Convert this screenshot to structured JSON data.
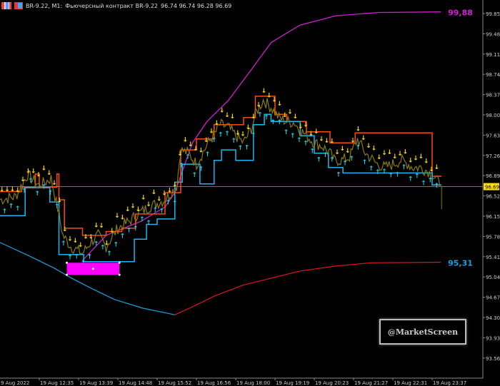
{
  "header": {
    "symbol": "BR-9.22, M1:",
    "description": "Фьючерсный контракт BR-9.22",
    "ohlc": "96.74 96.74 96.28 96.69"
  },
  "watermark": "@MarketScreen",
  "colors": {
    "price": "#8a7a10",
    "upper_step": "#ff4a10",
    "lower_step": "#18b8f0",
    "upper_envelope": "#d020d0",
    "lower_envelope_a": "#1aa0e0",
    "lower_envelope_b": "#dd1818",
    "arrow_down": "#ffe000",
    "arrow_up": "#20d0e0",
    "box": "#ff00ff",
    "axis": "#888888"
  },
  "chart_data": {
    "type": "line",
    "title": "BR-9.22, M1",
    "ylim": [
      93.4,
      100.0
    ],
    "yticks": [
      "99.85",
      "99.48",
      "99.11",
      "98.74",
      "98.37",
      "98.00",
      "97.63",
      "97.26",
      "96.89",
      "96.52",
      "96.15",
      "95.78",
      "95.41",
      "95.04",
      "94.67",
      "94.30",
      "93.93",
      "93.56"
    ],
    "xticks": [
      "9 Aug 2022",
      "19 Aug 12:35",
      "19 Aug 13:39",
      "19 Aug 14:48",
      "19 Aug 15:52",
      "19 Aug 16:56",
      "19 Aug 18:00",
      "19 Aug 19:19",
      "19 Aug 20:23",
      "19 Aug 21:27",
      "19 Aug 22:31",
      "19 Aug 23:37"
    ],
    "current_price": "96.69",
    "upper_label": "99,88",
    "lower_label": "95,31",
    "series": [
      {
        "name": "price",
        "points": [
          [
            0,
            96.45
          ],
          [
            4,
            96.51
          ],
          [
            7,
            96.91
          ],
          [
            10,
            96.71
          ],
          [
            13,
            96.84
          ],
          [
            15,
            96.19
          ],
          [
            16,
            95.8
          ],
          [
            18,
            95.6
          ],
          [
            21,
            95.47
          ],
          [
            23,
            95.67
          ],
          [
            25,
            95.8
          ],
          [
            27,
            95.6
          ],
          [
            30,
            95.93
          ],
          [
            33,
            96.06
          ],
          [
            35,
            96.19
          ],
          [
            38,
            96.32
          ],
          [
            42,
            96.45
          ],
          [
            45,
            96.71
          ],
          [
            46,
            97.36
          ],
          [
            48,
            97.3
          ],
          [
            50,
            97.1
          ],
          [
            53,
            97.49
          ],
          [
            55,
            97.69
          ],
          [
            56,
            97.82
          ],
          [
            58,
            97.78
          ],
          [
            60,
            97.62
          ],
          [
            62,
            97.49
          ],
          [
            64,
            97.75
          ],
          [
            65,
            98.01
          ],
          [
            67,
            98.27
          ],
          [
            69,
            98.14
          ],
          [
            71,
            97.95
          ],
          [
            73,
            97.88
          ],
          [
            75,
            97.86
          ],
          [
            76,
            97.75
          ],
          [
            78,
            97.62
          ],
          [
            80,
            97.49
          ],
          [
            82,
            97.43
          ],
          [
            84,
            97.3
          ],
          [
            85,
            97.17
          ],
          [
            87,
            97.17
          ],
          [
            89,
            97.23
          ],
          [
            91,
            97.56
          ],
          [
            93,
            97.3
          ],
          [
            95,
            97.17
          ],
          [
            96,
            97.1
          ],
          [
            98,
            97.04
          ],
          [
            100,
            97.1
          ],
          [
            102,
            97.17
          ],
          [
            104,
            97.1
          ],
          [
            105,
            97.04
          ],
          [
            107,
            97.04
          ],
          [
            109,
            96.97
          ],
          [
            111,
            96.84
          ],
          [
            112,
            96.69
          ]
        ]
      },
      {
        "name": "upper_step",
        "points": [
          [
            0,
            96.6
          ],
          [
            5.5,
            96.6
          ],
          [
            5.5,
            96.68
          ],
          [
            9,
            96.68
          ],
          [
            9,
            96.92
          ],
          [
            10,
            96.92
          ],
          [
            10,
            96.68
          ],
          [
            14.5,
            96.68
          ],
          [
            14.5,
            96.92
          ],
          [
            15,
            96.92
          ],
          [
            15,
            96.45
          ],
          [
            16.4,
            96.45
          ],
          [
            16.4,
            95.93
          ],
          [
            21,
            95.93
          ],
          [
            21,
            95.8
          ],
          [
            27,
            95.8
          ],
          [
            27,
            95.87
          ],
          [
            31,
            95.87
          ],
          [
            31,
            95.93
          ],
          [
            34.5,
            95.93
          ],
          [
            34.5,
            96.19
          ],
          [
            42,
            96.19
          ],
          [
            42,
            96.58
          ],
          [
            46,
            96.58
          ],
          [
            46,
            97.36
          ],
          [
            50,
            97.36
          ],
          [
            50,
            97.56
          ],
          [
            54.5,
            97.56
          ],
          [
            54.5,
            97.82
          ],
          [
            62,
            97.82
          ],
          [
            62,
            97.95
          ],
          [
            65,
            97.95
          ],
          [
            65,
            98.34
          ],
          [
            70,
            98.34
          ],
          [
            70,
            98.01
          ],
          [
            73,
            98.01
          ],
          [
            73,
            97.88
          ],
          [
            78,
            97.88
          ],
          [
            78,
            97.69
          ],
          [
            84,
            97.69
          ],
          [
            84,
            97.49
          ],
          [
            90.4,
            97.49
          ],
          [
            90.4,
            97.67
          ],
          [
            110,
            97.67
          ],
          [
            110,
            96.88
          ],
          [
            112.4,
            96.88
          ]
        ]
      },
      {
        "name": "lower_step",
        "points": [
          [
            0,
            96.16
          ],
          [
            6.4,
            96.16
          ],
          [
            6.4,
            96.67
          ],
          [
            12.7,
            96.67
          ],
          [
            12.7,
            96.41
          ],
          [
            15,
            96.41
          ],
          [
            15,
            95.45
          ],
          [
            21.3,
            95.45
          ],
          [
            21.3,
            95.32
          ],
          [
            34.2,
            95.32
          ],
          [
            34.2,
            95.73
          ],
          [
            37.3,
            95.73
          ],
          [
            37.3,
            96.0
          ],
          [
            40,
            96.0
          ],
          [
            40,
            96.1
          ],
          [
            44.5,
            96.1
          ],
          [
            44.5,
            96.77
          ],
          [
            46.4,
            96.77
          ],
          [
            46.4,
            97.1
          ],
          [
            50.9,
            97.1
          ],
          [
            50.9,
            96.74
          ],
          [
            54.5,
            96.74
          ],
          [
            54.5,
            97.17
          ],
          [
            56.4,
            97.17
          ],
          [
            56.4,
            97.36
          ],
          [
            60,
            97.36
          ],
          [
            60,
            97.17
          ],
          [
            64.5,
            97.17
          ],
          [
            64.5,
            97.82
          ],
          [
            67.3,
            97.82
          ],
          [
            67.3,
            98.01
          ],
          [
            69,
            98.01
          ],
          [
            69,
            97.88
          ],
          [
            76.4,
            97.88
          ],
          [
            76.4,
            97.62
          ],
          [
            80,
            97.62
          ],
          [
            80,
            97.3
          ],
          [
            83.6,
            97.3
          ],
          [
            83.6,
            97.04
          ],
          [
            87.3,
            97.04
          ],
          [
            87.3,
            96.94
          ],
          [
            110,
            96.94
          ],
          [
            110,
            96.72
          ],
          [
            112.4,
            96.72
          ]
        ]
      },
      {
        "name": "upper_envelope",
        "points": [
          [
            21,
            95.34
          ],
          [
            27,
            95.8
          ],
          [
            36,
            96.06
          ],
          [
            42,
            96.32
          ],
          [
            44.5,
            96.58
          ],
          [
            46.4,
            96.97
          ],
          [
            49,
            97.49
          ],
          [
            52.7,
            97.88
          ],
          [
            58.2,
            98.27
          ],
          [
            63.6,
            98.79
          ],
          [
            69,
            99.32
          ],
          [
            76.4,
            99.64
          ],
          [
            85.5,
            99.81
          ],
          [
            96.4,
            99.87
          ],
          [
            112.2,
            99.88
          ]
        ]
      },
      {
        "name": "lower_envelope",
        "points": [
          [
            0,
            95.67
          ],
          [
            7.3,
            95.43
          ],
          [
            13.6,
            95.21
          ],
          [
            18.2,
            95.02
          ],
          [
            23.6,
            94.82
          ],
          [
            29.1,
            94.63
          ],
          [
            36.4,
            94.47
          ],
          [
            44.5,
            94.35
          ],
          [
            49.1,
            94.5
          ],
          [
            54.5,
            94.69
          ],
          [
            61.8,
            94.89
          ],
          [
            69.1,
            95.02
          ],
          [
            76.4,
            95.15
          ],
          [
            85.5,
            95.24
          ],
          [
            94.5,
            95.3
          ],
          [
            112.2,
            95.31
          ]
        ]
      }
    ],
    "box": {
      "x0": 17,
      "x1": 30.4,
      "y_top": 95.3,
      "y_bottom": 95.08
    }
  }
}
